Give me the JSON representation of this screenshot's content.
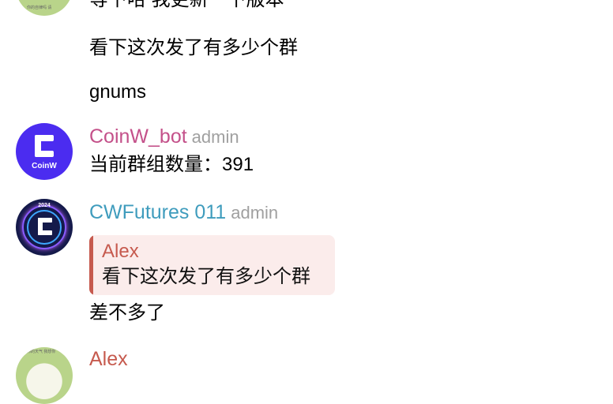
{
  "messages": [
    {
      "avatar_text": "你的自律吗 请",
      "lines": [
        "等下哈 我更新一下版本",
        "看下这次发了有多少个群",
        "gnums"
      ]
    },
    {
      "sender": "CoinW_bot",
      "role": "admin",
      "avatar_brand": "CoinW",
      "lines": [
        "当前群组数量：391"
      ]
    },
    {
      "sender": "CWFutures 011",
      "role": "admin",
      "avatar_year": "2024",
      "reply_to": {
        "name": "Alex",
        "text": "看下这次发了有多少个群"
      },
      "lines": [
        "差不多了"
      ]
    },
    {
      "sender": "Alex",
      "role": "",
      "avatar_text": "你的天气 我想你"
    }
  ],
  "colors": {
    "bot_name": "#c4518a",
    "futures_name": "#3f9cbd",
    "reply_accent": "#c65a4e",
    "reply_background": "#fbeceb",
    "role_text": "#a0a0a0",
    "bot_avatar": "#4b2cf0"
  }
}
